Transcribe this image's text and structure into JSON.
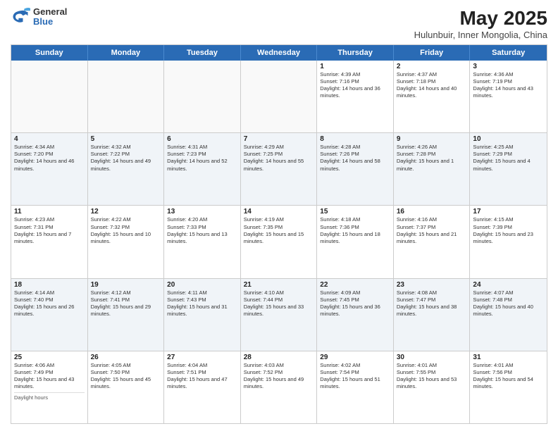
{
  "header": {
    "logo": {
      "general": "General",
      "blue": "Blue"
    },
    "title": "May 2025",
    "subtitle": "Hulunbuir, Inner Mongolia, China"
  },
  "calendar": {
    "days": [
      "Sunday",
      "Monday",
      "Tuesday",
      "Wednesday",
      "Thursday",
      "Friday",
      "Saturday"
    ],
    "weeks": [
      [
        {
          "day": "",
          "empty": true
        },
        {
          "day": "",
          "empty": true
        },
        {
          "day": "",
          "empty": true
        },
        {
          "day": "",
          "empty": true
        },
        {
          "day": "1",
          "sunrise": "Sunrise: 4:39 AM",
          "sunset": "Sunset: 7:16 PM",
          "daylight": "Daylight: 14 hours and 36 minutes."
        },
        {
          "day": "2",
          "sunrise": "Sunrise: 4:37 AM",
          "sunset": "Sunset: 7:18 PM",
          "daylight": "Daylight: 14 hours and 40 minutes."
        },
        {
          "day": "3",
          "sunrise": "Sunrise: 4:36 AM",
          "sunset": "Sunset: 7:19 PM",
          "daylight": "Daylight: 14 hours and 43 minutes."
        }
      ],
      [
        {
          "day": "4",
          "sunrise": "Sunrise: 4:34 AM",
          "sunset": "Sunset: 7:20 PM",
          "daylight": "Daylight: 14 hours and 46 minutes."
        },
        {
          "day": "5",
          "sunrise": "Sunrise: 4:32 AM",
          "sunset": "Sunset: 7:22 PM",
          "daylight": "Daylight: 14 hours and 49 minutes."
        },
        {
          "day": "6",
          "sunrise": "Sunrise: 4:31 AM",
          "sunset": "Sunset: 7:23 PM",
          "daylight": "Daylight: 14 hours and 52 minutes."
        },
        {
          "day": "7",
          "sunrise": "Sunrise: 4:29 AM",
          "sunset": "Sunset: 7:25 PM",
          "daylight": "Daylight: 14 hours and 55 minutes."
        },
        {
          "day": "8",
          "sunrise": "Sunrise: 4:28 AM",
          "sunset": "Sunset: 7:26 PM",
          "daylight": "Daylight: 14 hours and 58 minutes."
        },
        {
          "day": "9",
          "sunrise": "Sunrise: 4:26 AM",
          "sunset": "Sunset: 7:28 PM",
          "daylight": "Daylight: 15 hours and 1 minute."
        },
        {
          "day": "10",
          "sunrise": "Sunrise: 4:25 AM",
          "sunset": "Sunset: 7:29 PM",
          "daylight": "Daylight: 15 hours and 4 minutes."
        }
      ],
      [
        {
          "day": "11",
          "sunrise": "Sunrise: 4:23 AM",
          "sunset": "Sunset: 7:31 PM",
          "daylight": "Daylight: 15 hours and 7 minutes."
        },
        {
          "day": "12",
          "sunrise": "Sunrise: 4:22 AM",
          "sunset": "Sunset: 7:32 PM",
          "daylight": "Daylight: 15 hours and 10 minutes."
        },
        {
          "day": "13",
          "sunrise": "Sunrise: 4:20 AM",
          "sunset": "Sunset: 7:33 PM",
          "daylight": "Daylight: 15 hours and 13 minutes."
        },
        {
          "day": "14",
          "sunrise": "Sunrise: 4:19 AM",
          "sunset": "Sunset: 7:35 PM",
          "daylight": "Daylight: 15 hours and 15 minutes."
        },
        {
          "day": "15",
          "sunrise": "Sunrise: 4:18 AM",
          "sunset": "Sunset: 7:36 PM",
          "daylight": "Daylight: 15 hours and 18 minutes."
        },
        {
          "day": "16",
          "sunrise": "Sunrise: 4:16 AM",
          "sunset": "Sunset: 7:37 PM",
          "daylight": "Daylight: 15 hours and 21 minutes."
        },
        {
          "day": "17",
          "sunrise": "Sunrise: 4:15 AM",
          "sunset": "Sunset: 7:39 PM",
          "daylight": "Daylight: 15 hours and 23 minutes."
        }
      ],
      [
        {
          "day": "18",
          "sunrise": "Sunrise: 4:14 AM",
          "sunset": "Sunset: 7:40 PM",
          "daylight": "Daylight: 15 hours and 26 minutes."
        },
        {
          "day": "19",
          "sunrise": "Sunrise: 4:12 AM",
          "sunset": "Sunset: 7:41 PM",
          "daylight": "Daylight: 15 hours and 29 minutes."
        },
        {
          "day": "20",
          "sunrise": "Sunrise: 4:11 AM",
          "sunset": "Sunset: 7:43 PM",
          "daylight": "Daylight: 15 hours and 31 minutes."
        },
        {
          "day": "21",
          "sunrise": "Sunrise: 4:10 AM",
          "sunset": "Sunset: 7:44 PM",
          "daylight": "Daylight: 15 hours and 33 minutes."
        },
        {
          "day": "22",
          "sunrise": "Sunrise: 4:09 AM",
          "sunset": "Sunset: 7:45 PM",
          "daylight": "Daylight: 15 hours and 36 minutes."
        },
        {
          "day": "23",
          "sunrise": "Sunrise: 4:08 AM",
          "sunset": "Sunset: 7:47 PM",
          "daylight": "Daylight: 15 hours and 38 minutes."
        },
        {
          "day": "24",
          "sunrise": "Sunrise: 4:07 AM",
          "sunset": "Sunset: 7:48 PM",
          "daylight": "Daylight: 15 hours and 40 minutes."
        }
      ],
      [
        {
          "day": "25",
          "sunrise": "Sunrise: 4:06 AM",
          "sunset": "Sunset: 7:49 PM",
          "daylight": "Daylight: 15 hours and 43 minutes."
        },
        {
          "day": "26",
          "sunrise": "Sunrise: 4:05 AM",
          "sunset": "Sunset: 7:50 PM",
          "daylight": "Daylight: 15 hours and 45 minutes."
        },
        {
          "day": "27",
          "sunrise": "Sunrise: 4:04 AM",
          "sunset": "Sunset: 7:51 PM",
          "daylight": "Daylight: 15 hours and 47 minutes."
        },
        {
          "day": "28",
          "sunrise": "Sunrise: 4:03 AM",
          "sunset": "Sunset: 7:52 PM",
          "daylight": "Daylight: 15 hours and 49 minutes."
        },
        {
          "day": "29",
          "sunrise": "Sunrise: 4:02 AM",
          "sunset": "Sunset: 7:54 PM",
          "daylight": "Daylight: 15 hours and 51 minutes."
        },
        {
          "day": "30",
          "sunrise": "Sunrise: 4:01 AM",
          "sunset": "Sunset: 7:55 PM",
          "daylight": "Daylight: 15 hours and 53 minutes."
        },
        {
          "day": "31",
          "sunrise": "Sunrise: 4:01 AM",
          "sunset": "Sunset: 7:56 PM",
          "daylight": "Daylight: 15 hours and 54 minutes."
        }
      ]
    ],
    "daylight_label": "Daylight hours"
  },
  "colors": {
    "header_bg": "#2a6bb5",
    "header_text": "#ffffff",
    "cell_alt": "#eef2f7"
  }
}
